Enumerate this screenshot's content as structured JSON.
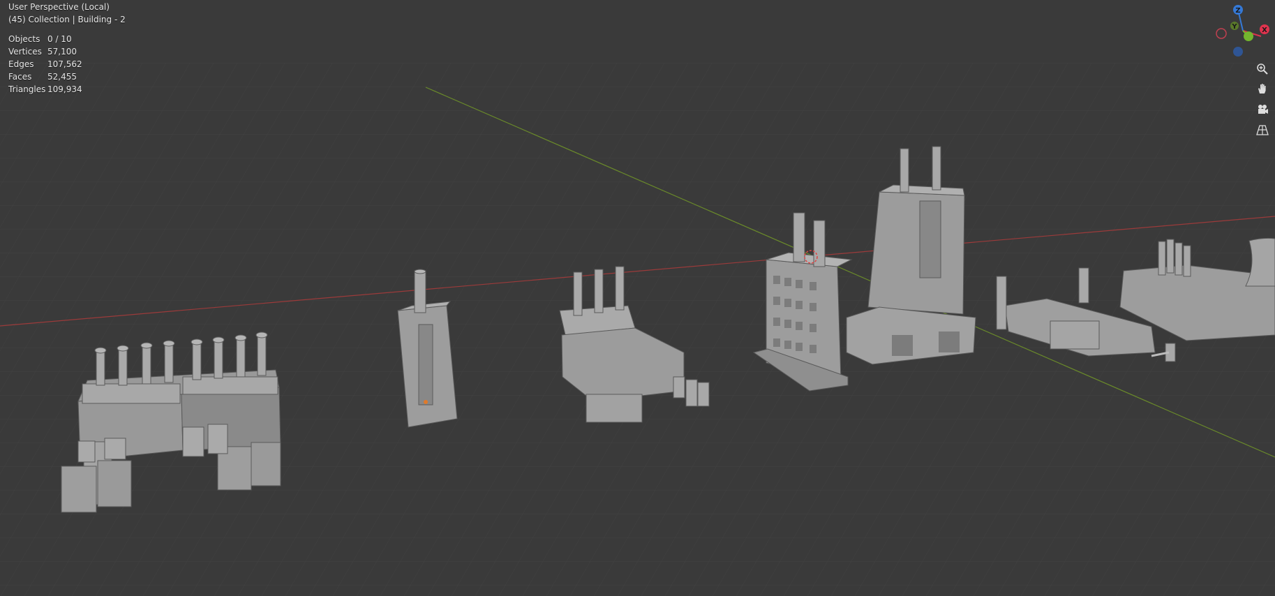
{
  "viewport": {
    "view_name": "User Perspective (Local)",
    "collection_line": "(45) Collection | Building - 2"
  },
  "stats": [
    {
      "label": "Objects",
      "value": "0 / 10"
    },
    {
      "label": "Vertices",
      "value": "57,100"
    },
    {
      "label": "Edges",
      "value": "107,562"
    },
    {
      "label": "Faces",
      "value": "52,455"
    },
    {
      "label": "Triangles",
      "value": "109,934"
    }
  ],
  "gizmo": {
    "x_label": "X",
    "y_label": "Y",
    "z_label": "Z",
    "x_color": "#e0334e",
    "y_color": "#73b52e",
    "z_color": "#3579d6"
  },
  "nav_icons": [
    "zoom-icon",
    "hand-pan-icon",
    "camera-icon",
    "perspective-grid-icon"
  ],
  "colors": {
    "background": "#3a3a3a",
    "grid": "#434343",
    "x_axis": "#9c3a3a",
    "y_axis": "#6a8a2a",
    "model": "#9b9b9b"
  }
}
